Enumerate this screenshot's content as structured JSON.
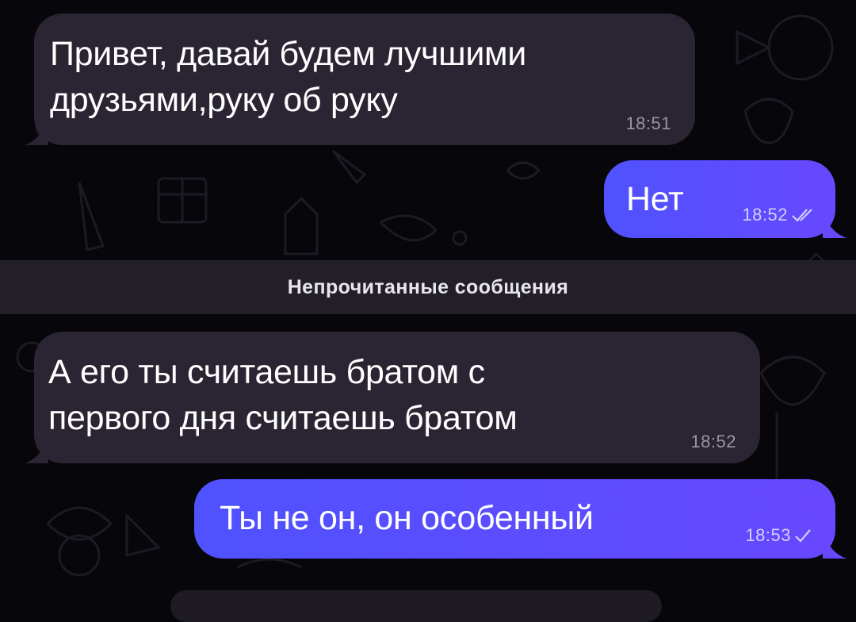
{
  "messages": [
    {
      "id": "m1",
      "direction": "incoming",
      "text": "Привет, давай будем лучшими\nдрузьями,руку об руку",
      "time": "18:51"
    },
    {
      "id": "m2",
      "direction": "outgoing",
      "text": "Нет",
      "time": "18:52",
      "status": "read"
    },
    {
      "id": "m3",
      "direction": "incoming",
      "text": "А его ты считаешь братом с\nпервого дня считаешь братом",
      "time": "18:52"
    },
    {
      "id": "m4",
      "direction": "outgoing",
      "text": "Ты не он, он особенный",
      "time": "18:53",
      "status": "sent"
    }
  ],
  "divider": {
    "label": "Непрочитанные сообщения"
  },
  "colors": {
    "background": "#07060b",
    "incoming_bubble": "#2b2533",
    "outgoing_bubble_start": "#4f52ff",
    "outgoing_bubble_end": "#6848ff",
    "divider_bar": "#231f29"
  },
  "icons": {
    "read_status": "double-check-icon",
    "sent_status": "check-icon"
  }
}
